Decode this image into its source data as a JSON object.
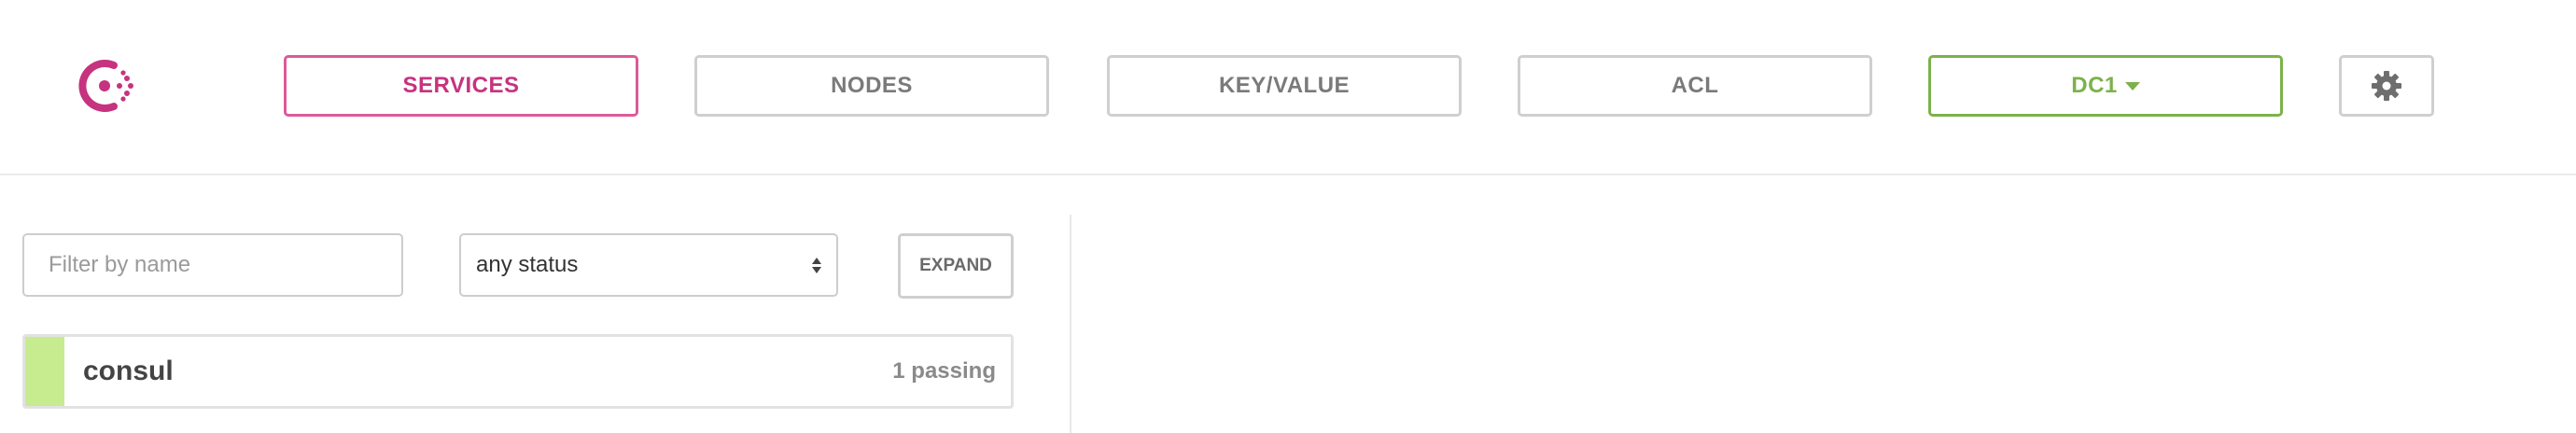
{
  "nav": {
    "items": [
      {
        "label": "SERVICES",
        "active": true
      },
      {
        "label": "NODES",
        "active": false
      },
      {
        "label": "KEY/VALUE",
        "active": false
      },
      {
        "label": "ACL",
        "active": false
      }
    ],
    "datacenter": {
      "label": "DC1",
      "icon": "chevron-down-icon"
    },
    "settings_icon": "gear-icon",
    "logo_icon": "consul-logo-icon"
  },
  "filters": {
    "name_placeholder": "Filter by name",
    "name_value": "",
    "status_selected": "any status",
    "expand_label": "EXPAND"
  },
  "services": [
    {
      "name": "consul",
      "status": "1 passing",
      "health_color": "#c6ec8f"
    }
  ],
  "colors": {
    "accent": "#c6337f",
    "active_border": "#db5a9a",
    "dc_green": "#7cb24a",
    "passing": "#c6ec8f"
  }
}
